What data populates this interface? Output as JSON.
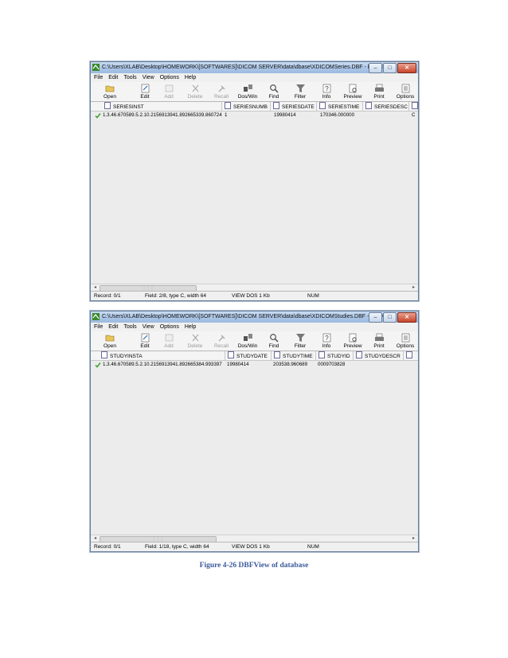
{
  "windows": [
    {
      "title": "C:\\Users\\XLAB\\Desktop\\HOMEWORK\\[SOFTWARES]\\DICOM SERVER\\data\\dbase\\XDICOMSeries.DBF - DBFVie...",
      "menu": [
        "File",
        "Edit",
        "Tools",
        "View",
        "Options",
        "Help"
      ],
      "toolbar": [
        "Open",
        "Edit",
        "Add",
        "Delete",
        "Recall",
        "Dos/Win",
        "Find",
        "Filter",
        "Info",
        "Preview",
        "Print",
        "Options"
      ],
      "columns": [
        "SERIESINST",
        "SERIESNUMB",
        "SERIESDATE",
        "SERIESTIME",
        "SERIESDESC"
      ],
      "rows": [
        [
          "1.3.46.670589.5.2.10.2156913941.892665339.860724",
          "1",
          "19980414",
          "170346.000000",
          "",
          "C"
        ]
      ],
      "status": {
        "record": "Record: 0/1",
        "field": "Field: 2/8, type C, width 64",
        "mode": "VIEW  DOS  1 Kb",
        "num": "NUM"
      }
    },
    {
      "title": "C:\\Users\\XLAB\\Desktop\\HOMEWORK\\[SOFTWARES]\\DICOM SERVER\\data\\dbase\\XDICOMStudies.DBF - DBFVi...",
      "menu": [
        "File",
        "Edit",
        "Tools",
        "View",
        "Options",
        "Help"
      ],
      "toolbar": [
        "Open",
        "Edit",
        "Add",
        "Delete",
        "Recall",
        "Dos/Win",
        "Find",
        "Filter",
        "Info",
        "Preview",
        "Print",
        "Options"
      ],
      "columns": [
        "STUDYINSTA",
        "STUDYDATE",
        "STUDYTIME",
        "STUDYID",
        "STUDYDESCR"
      ],
      "rows": [
        [
          "1.3.46.670589.5.2.10.2156913941.892665384.993397",
          "19980414",
          "203538.960689",
          "0009703828",
          ""
        ]
      ],
      "status": {
        "record": "Record: 0/1",
        "field": "Field: 1/18, type C, width 64",
        "mode": "VIEW  DOS  1 Kb",
        "num": "NUM"
      }
    }
  ],
  "caption": "Figure 4-26 DBFView of database"
}
